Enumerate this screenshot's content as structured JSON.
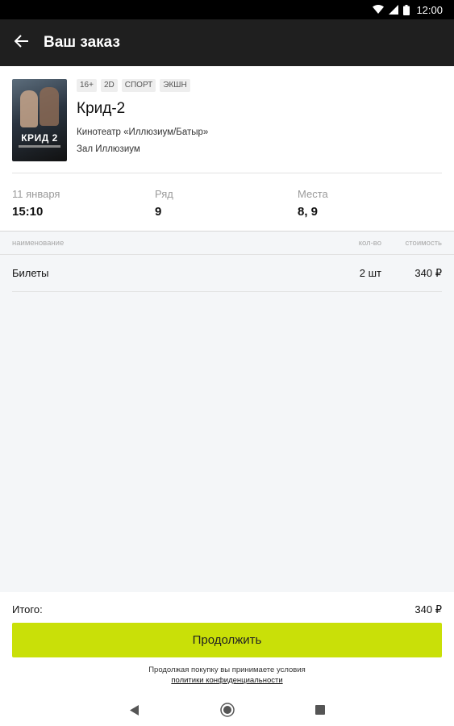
{
  "status_bar": {
    "time": "12:00"
  },
  "app_bar": {
    "title": "Ваш заказ"
  },
  "movie": {
    "poster_title": "КРИД 2",
    "tags": [
      "16+",
      "2D",
      "СПОРТ",
      "ЭКШН"
    ],
    "title": "Крид-2",
    "cinema": "Кинотеатр «Иллюзиум/Батыр»",
    "hall": "Зал Иллюзиум"
  },
  "session": {
    "date_label": "11 января",
    "time": "15:10",
    "row_label": "Ряд",
    "row": "9",
    "seats_label": "Места",
    "seats": "8, 9"
  },
  "table": {
    "headers": {
      "name": "наименование",
      "qty": "кол-во",
      "price": "стоимость"
    },
    "rows": [
      {
        "name": "Билеты",
        "qty": "2 шт",
        "price": "340 ₽"
      }
    ]
  },
  "footer": {
    "total_label": "Итого:",
    "total_value": "340 ₽",
    "continue_label": "Продолжить",
    "legal_text": "Продолжая покупку вы принимаете условия",
    "legal_link": "политики конфиденциальности"
  },
  "icons": {
    "back": "arrow-left-icon",
    "wifi": "wifi-icon",
    "signal": "signal-icon",
    "battery": "battery-icon",
    "nav_back": "nav-back-icon",
    "nav_home": "nav-home-icon",
    "nav_recents": "nav-recents-icon"
  },
  "colors": {
    "accent": "#c9e008",
    "app_bar": "#1f1f1f"
  }
}
